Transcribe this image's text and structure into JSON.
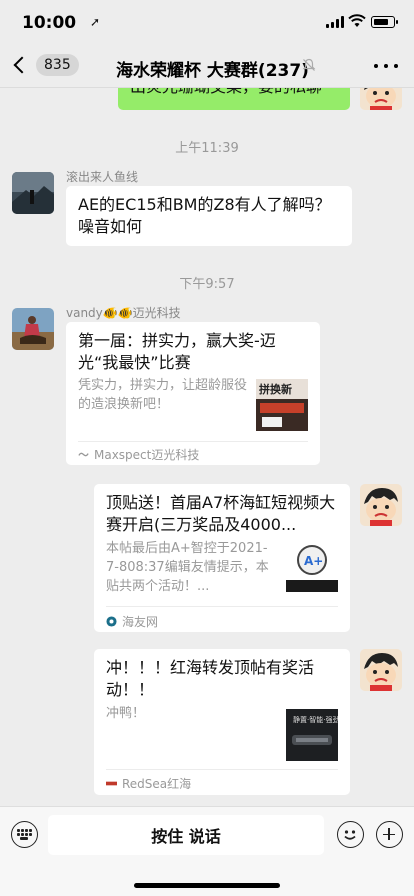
{
  "status_bar": {
    "time": "10:00",
    "location_icon": "location-arrow-icon",
    "battery_level": 0.8
  },
  "nav": {
    "unread_count": "835",
    "title": "海水荣耀杯 大赛群(237)",
    "mute_icon": "mute-bell-icon",
    "more_icon": "more-dots-icon"
  },
  "messages": {
    "partial_green_text": "出炎光珊瑚交菜，要的私聊",
    "timestamp_1": "上午11:39",
    "m1_sender": "滚出来人鱼线",
    "m1_text": "AE的EC15和BM的Z8有人了解吗？噪音如何",
    "timestamp_2": "下午9:57",
    "m2_sender": "vandy🐠🐠迈光科技",
    "m2_card": {
      "title": "第一届：拼实力，赢大奖-迈光“我最快”比赛",
      "desc": "凭实力，拼实力，让超龄服役的造浪换新吧！",
      "source": "Maxspect迈光科技"
    },
    "m3_card": {
      "title": "顶贴送！首届A7杯海缸短视频大赛开启(三万奖品及4000...",
      "desc": "本帖最后由A+智控于2021-7-808:37编辑友情提示，本贴共两个活动！...",
      "source": "海友网"
    },
    "m4_card": {
      "title": "冲！！！红海转发顶帖有奖活动！！",
      "desc": "冲鸭！",
      "source": "RedSea红海"
    }
  },
  "input_bar": {
    "hold_to_talk": "按住 说话"
  },
  "colors": {
    "background": "#ededed",
    "green_bubble": "#95ec69",
    "white_bubble": "#ffffff"
  }
}
